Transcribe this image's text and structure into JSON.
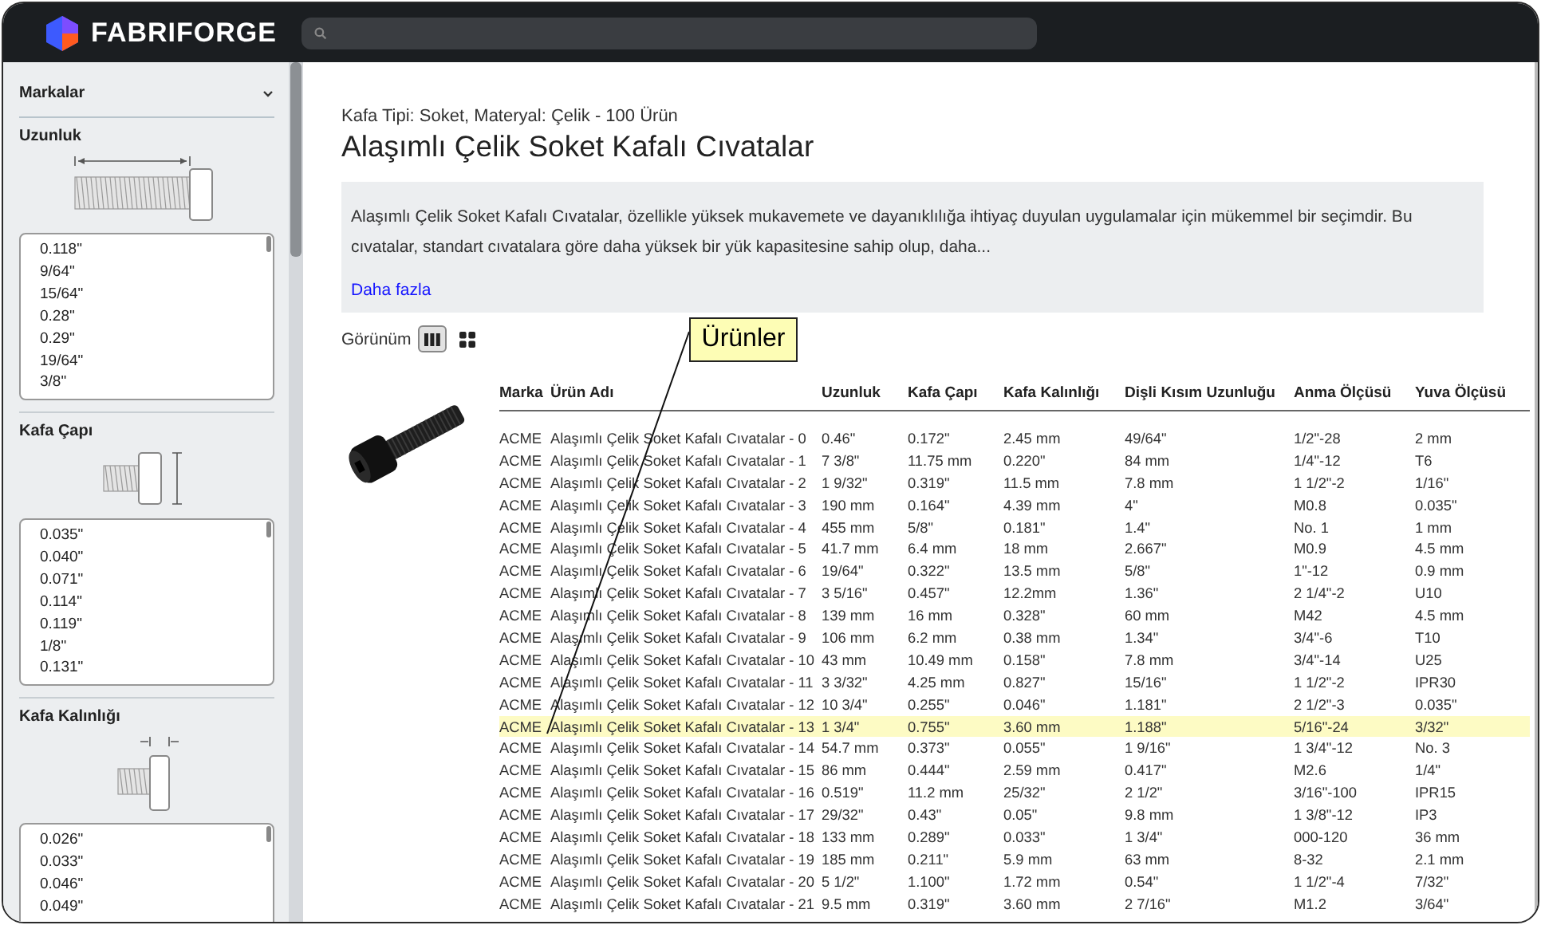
{
  "header": {
    "brand": "FABRIFORGE"
  },
  "sidebar": {
    "brands_section": {
      "label": "Markalar",
      "expanded": false
    },
    "filters": [
      {
        "label": "Uzunluk",
        "kind": "length",
        "values": [
          "0.118\"",
          "9/64\"",
          "15/64\"",
          "0.28\"",
          "0.29\"",
          "19/64\"",
          "3/8\""
        ]
      },
      {
        "label": "Kafa Çapı",
        "kind": "head_diameter",
        "values": [
          "0.035\"",
          "0.040\"",
          "0.071\"",
          "0.114\"",
          "0.119\"",
          "1/8\"",
          "0.131\""
        ]
      },
      {
        "label": "Kafa Kalınlığı",
        "kind": "head_height",
        "values": [
          "0.026\"",
          "0.033\"",
          "0.046\"",
          "0.049\""
        ]
      }
    ]
  },
  "main": {
    "breadcrumb": "Kafa Tipi: Soket, Materyal: Çelik - 100 Ürün",
    "title": "Alaşımlı Çelik Soket Kafalı Cıvatalar",
    "description": "Alaşımlı Çelik Soket Kafalı Cıvatalar, özellikle yüksek mukavemete ve dayanıklılığa ihtiyaç duyulan uygulamalar için mükemmel bir seçimdir. Bu cıvatalar, standart cıvatalara göre daha yüksek bir yük kapasitesine sahip olup, daha...",
    "more_link": "Daha fazla",
    "view": {
      "label": "Görünüm",
      "options": [
        {
          "kind": "columns",
          "selected": true
        },
        {
          "kind": "grid",
          "selected": false
        }
      ]
    },
    "callout": {
      "text": "Ürünler"
    },
    "table": {
      "columns": [
        "Marka",
        "Ürün Adı",
        "Uzunluk",
        "Kafa Çapı",
        "Kafa Kalınlığı",
        "Dişli Kısım Uzunluğu",
        "Anma Ölçüsü",
        "Yuva Ölçüsü"
      ],
      "rows": [
        {
          "selected": false,
          "cells": [
            "ACME",
            "Alaşımlı Çelik Soket Kafalı Cıvatalar - 0",
            "0.46\"",
            "0.172\"",
            "2.45 mm",
            "49/64\"",
            "1/2\"-28",
            "2 mm"
          ]
        },
        {
          "selected": false,
          "cells": [
            "ACME",
            "Alaşımlı Çelik Soket Kafalı Cıvatalar - 1",
            "7 3/8\"",
            "11.75 mm",
            "0.220\"",
            "84 mm",
            "1/4\"-12",
            "T6"
          ]
        },
        {
          "selected": false,
          "cells": [
            "ACME",
            "Alaşımlı Çelik Soket Kafalı Cıvatalar - 2",
            "1 9/32\"",
            "0.319\"",
            "11.5 mm",
            "7.8 mm",
            "1 1/2\"-2",
            "1/16\""
          ]
        },
        {
          "selected": false,
          "cells": [
            "ACME",
            "Alaşımlı Çelik Soket Kafalı Cıvatalar - 3",
            "190 mm",
            "0.164\"",
            "4.39 mm",
            "4\"",
            "M0.8",
            "0.035\""
          ]
        },
        {
          "selected": false,
          "cells": [
            "ACME",
            "Alaşımlı Çelik Soket Kafalı Cıvatalar - 4",
            "455 mm",
            "5/8\"",
            "0.181\"",
            "1.4\"",
            "No. 1",
            "1 mm"
          ]
        },
        {
          "selected": false,
          "cells": [
            "ACME",
            "Alaşımlı Çelik Soket Kafalı Cıvatalar - 5",
            "41.7 mm",
            "6.4 mm",
            "18 mm",
            "2.667\"",
            "M0.9",
            "4.5 mm"
          ]
        },
        {
          "selected": false,
          "cells": [
            "ACME",
            "Alaşımlı Çelik Soket Kafalı Cıvatalar - 6",
            "19/64\"",
            "0.322\"",
            "13.5 mm",
            "5/8\"",
            "1\"-12",
            "0.9 mm"
          ]
        },
        {
          "selected": false,
          "cells": [
            "ACME",
            "Alaşımlı Çelik Soket Kafalı Cıvatalar - 7",
            "3 5/16\"",
            "0.457\"",
            "12.2mm",
            "1.36\"",
            "2 1/4\"-2",
            "U10"
          ]
        },
        {
          "selected": false,
          "cells": [
            "ACME",
            "Alaşımlı Çelik Soket Kafalı Cıvatalar - 8",
            "139 mm",
            "16 mm",
            "0.328\"",
            "60 mm",
            "M42",
            "4.5 mm"
          ]
        },
        {
          "selected": false,
          "cells": [
            "ACME",
            "Alaşımlı Çelik Soket Kafalı Cıvatalar - 9",
            "106 mm",
            "6.2 mm",
            "0.38 mm",
            "1.34\"",
            "3/4\"-6",
            "T10"
          ]
        },
        {
          "selected": false,
          "cells": [
            "ACME",
            "Alaşımlı Çelik Soket Kafalı Cıvatalar - 10",
            "43 mm",
            "10.49 mm",
            "0.158\"",
            "7.8 mm",
            "3/4\"-14",
            "U25"
          ]
        },
        {
          "selected": false,
          "cells": [
            "ACME",
            "Alaşımlı Çelik Soket Kafalı Cıvatalar - 11",
            "3 3/32\"",
            "4.25 mm",
            "0.827\"",
            "15/16\"",
            "1 1/2\"-2",
            "IPR30"
          ]
        },
        {
          "selected": false,
          "cells": [
            "ACME",
            "Alaşımlı Çelik Soket Kafalı Cıvatalar - 12",
            "10 3/4\"",
            "0.255\"",
            "0.046\"",
            "1.181\"",
            "2 1/2\"-3",
            "0.035\""
          ]
        },
        {
          "selected": true,
          "cells": [
            "ACME",
            "Alaşımlı Çelik Soket Kafalı Cıvatalar - 13",
            "1 3/4\"",
            "0.755\"",
            "3.60 mm",
            "1.188\"",
            "5/16\"-24",
            "3/32\""
          ]
        },
        {
          "selected": false,
          "cells": [
            "ACME",
            "Alaşımlı Çelik Soket Kafalı Cıvatalar - 14",
            "54.7 mm",
            "0.373\"",
            "0.055\"",
            "1 9/16\"",
            "1 3/4\"-12",
            "No. 3"
          ]
        },
        {
          "selected": false,
          "cells": [
            "ACME",
            "Alaşımlı Çelik Soket Kafalı Cıvatalar - 15",
            "86 mm",
            "0.444\"",
            "2.59 mm",
            "0.417\"",
            "M2.6",
            "1/4\""
          ]
        },
        {
          "selected": false,
          "cells": [
            "ACME",
            "Alaşımlı Çelik Soket Kafalı Cıvatalar - 16",
            "0.519\"",
            "11.2 mm",
            "25/32\"",
            "2 1/2\"",
            "3/16\"-100",
            "IPR15"
          ]
        },
        {
          "selected": false,
          "cells": [
            "ACME",
            "Alaşımlı Çelik Soket Kafalı Cıvatalar - 17",
            "29/32\"",
            "0.43\"",
            "0.05\"",
            "9.8 mm",
            "1 3/8\"-12",
            "IP3"
          ]
        },
        {
          "selected": false,
          "cells": [
            "ACME",
            "Alaşımlı Çelik Soket Kafalı Cıvatalar - 18",
            "133 mm",
            "0.289\"",
            "0.033\"",
            "1 3/4\"",
            "000-120",
            "36 mm"
          ]
        },
        {
          "selected": false,
          "cells": [
            "ACME",
            "Alaşımlı Çelik Soket Kafalı Cıvatalar - 19",
            "185 mm",
            "0.211\"",
            "5.9 mm",
            "63 mm",
            "8-32",
            "2.1 mm"
          ]
        },
        {
          "selected": false,
          "cells": [
            "ACME",
            "Alaşımlı Çelik Soket Kafalı Cıvatalar - 20",
            "5 1/2\"",
            "1.100\"",
            "1.72 mm",
            "0.54\"",
            "1 1/2\"-4",
            "7/32\""
          ]
        },
        {
          "selected": false,
          "cells": [
            "ACME",
            "Alaşımlı Çelik Soket Kafalı Cıvatalar - 21",
            "9.5 mm",
            "0.319\"",
            "3.60 mm",
            "2 7/16\"",
            "M1.2",
            "3/64\""
          ]
        }
      ]
    }
  }
}
